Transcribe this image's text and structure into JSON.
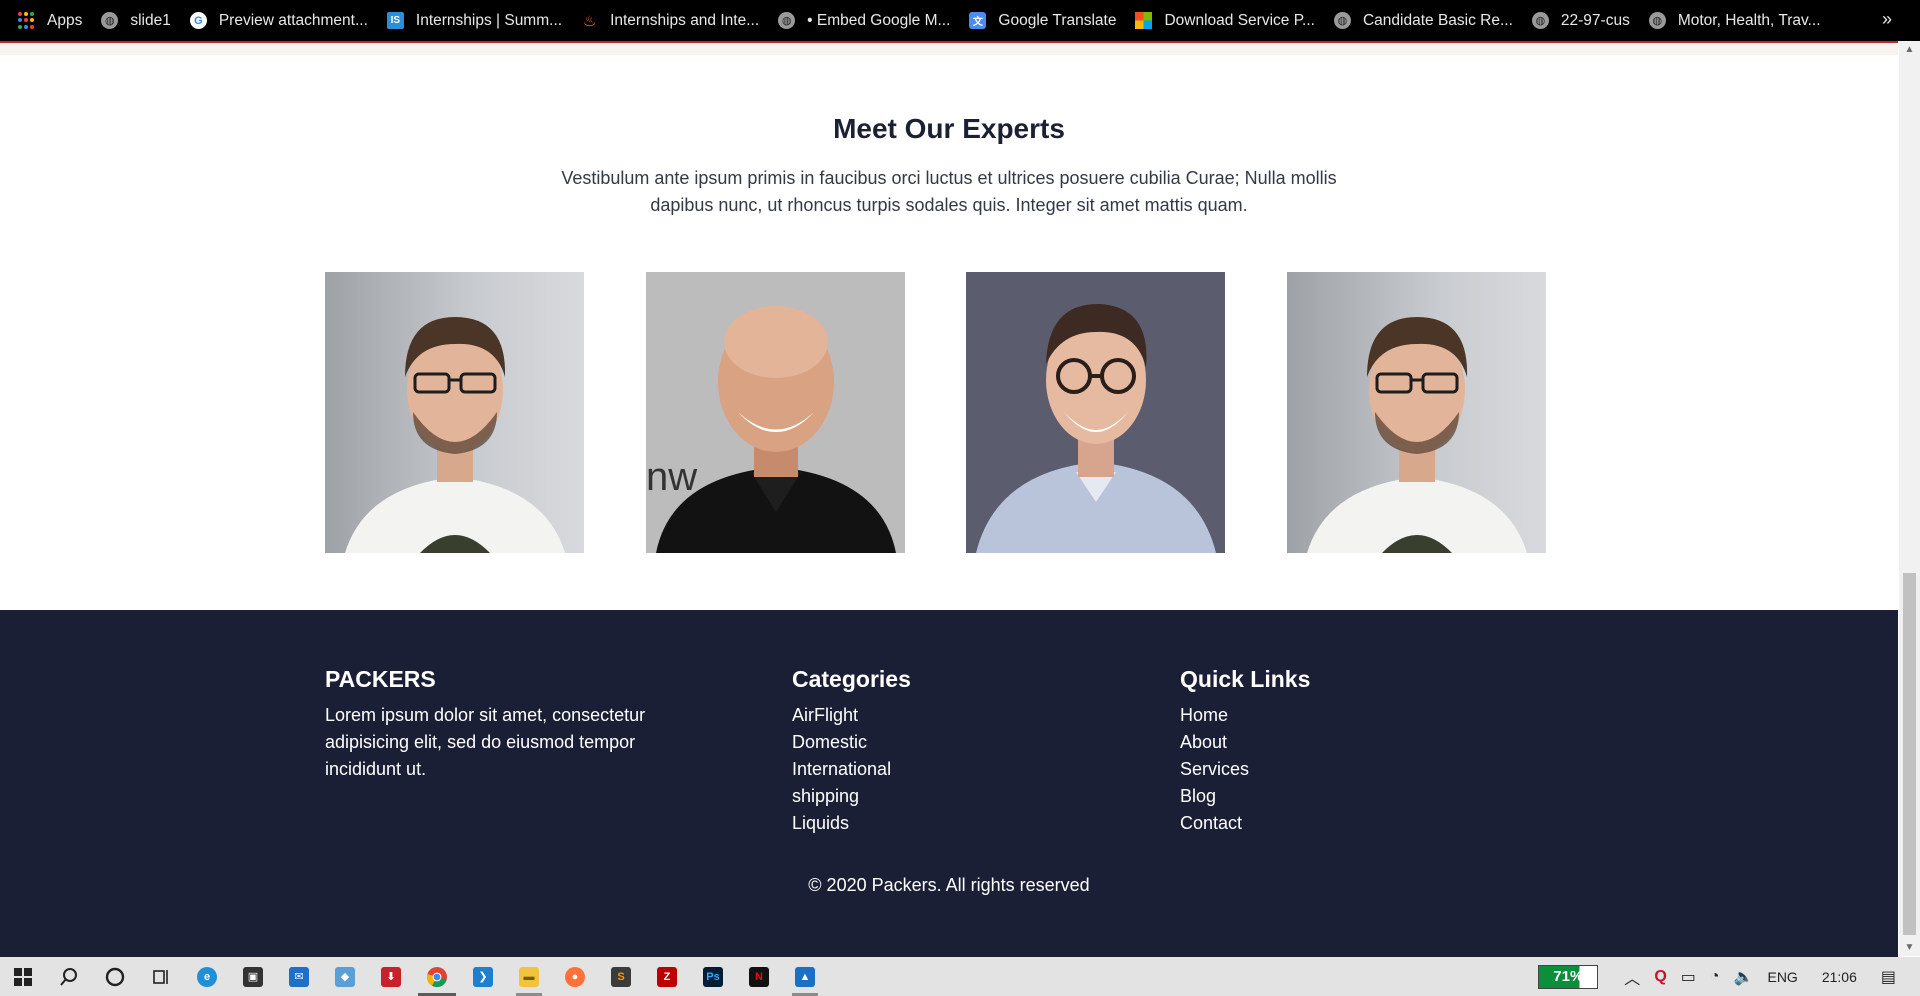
{
  "bookmarks": {
    "items": [
      {
        "label": "Apps",
        "icon": "apps-grid-icon"
      },
      {
        "label": "slide1",
        "icon": "globe-icon"
      },
      {
        "label": "Preview attachment...",
        "icon": "google-icon"
      },
      {
        "label": "Internships | Summ...",
        "icon": "internshala-icon"
      },
      {
        "label": "Internships and Inte...",
        "icon": "flame-icon"
      },
      {
        "label": "• Embed Google M...",
        "icon": "globe-icon"
      },
      {
        "label": "Google Translate",
        "icon": "translate-icon"
      },
      {
        "label": "Download Service P...",
        "icon": "microsoft-icon"
      },
      {
        "label": "Candidate Basic Re...",
        "icon": "globe-icon"
      },
      {
        "label": "22-97-cus",
        "icon": "globe-icon"
      },
      {
        "label": "Motor, Health, Trav...",
        "icon": "globe-icon"
      }
    ],
    "more": "»"
  },
  "experts": {
    "title": "Meet Our Experts",
    "description": "Vestibulum ante ipsum primis in faucibus orci luctus et ultrices posuere cubilia Curae; Nulla mollis dapibus nunc, ut rhoncus turpis sodales quis. Integer sit amet mattis quam."
  },
  "footer": {
    "brand": {
      "title": "PACKERS",
      "text": "Lorem ipsum dolor sit amet, consectetur adipisicing elit, sed do eiusmod tempor incididunt ut."
    },
    "categories": {
      "title": "Categories",
      "items": [
        "AirFlight",
        "Domestic",
        "International",
        "shipping",
        "Liquids"
      ]
    },
    "quick_links": {
      "title": "Quick Links",
      "items": [
        "Home",
        "About",
        "Services",
        "Blog",
        "Contact"
      ]
    },
    "copyright": "© 2020 Packers. All rights reserved"
  },
  "taskbar": {
    "battery": "71%",
    "language": "ENG",
    "time": "21:06"
  },
  "colors": {
    "footer_bg": "#1b1f35",
    "accent_red": "#c0282c",
    "battery_green": "#0b8f3a"
  }
}
